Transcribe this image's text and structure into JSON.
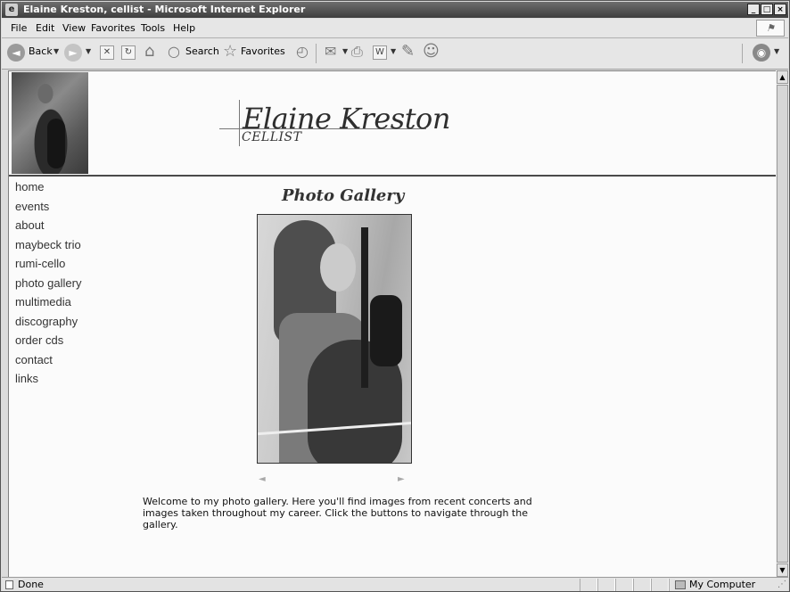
{
  "window": {
    "title": "Elaine Kreston, cellist - Microsoft Internet Explorer"
  },
  "menu": [
    "File",
    "Edit",
    "View",
    "Favorites",
    "Tools",
    "Help"
  ],
  "toolbar": {
    "back_label": "Back",
    "search_label": "Search",
    "favorites_label": "Favorites"
  },
  "header": {
    "name": "Elaine Kreston",
    "subtitle": "CELLIST"
  },
  "nav": {
    "items": [
      "home",
      "events",
      "about",
      "maybeck trio",
      "rumi-cello",
      "photo gallery",
      "multimedia",
      "discography",
      "order cds",
      "contact",
      "links"
    ]
  },
  "gallery": {
    "title": "Photo Gallery",
    "prev_arrow": "◄",
    "next_arrow": "►",
    "welcome": "Welcome to my photo gallery. Here you'll find images from recent concerts and images taken throughout my career. Click the buttons to navigate through the gallery."
  },
  "status": {
    "text": "Done",
    "zone": "My Computer"
  }
}
